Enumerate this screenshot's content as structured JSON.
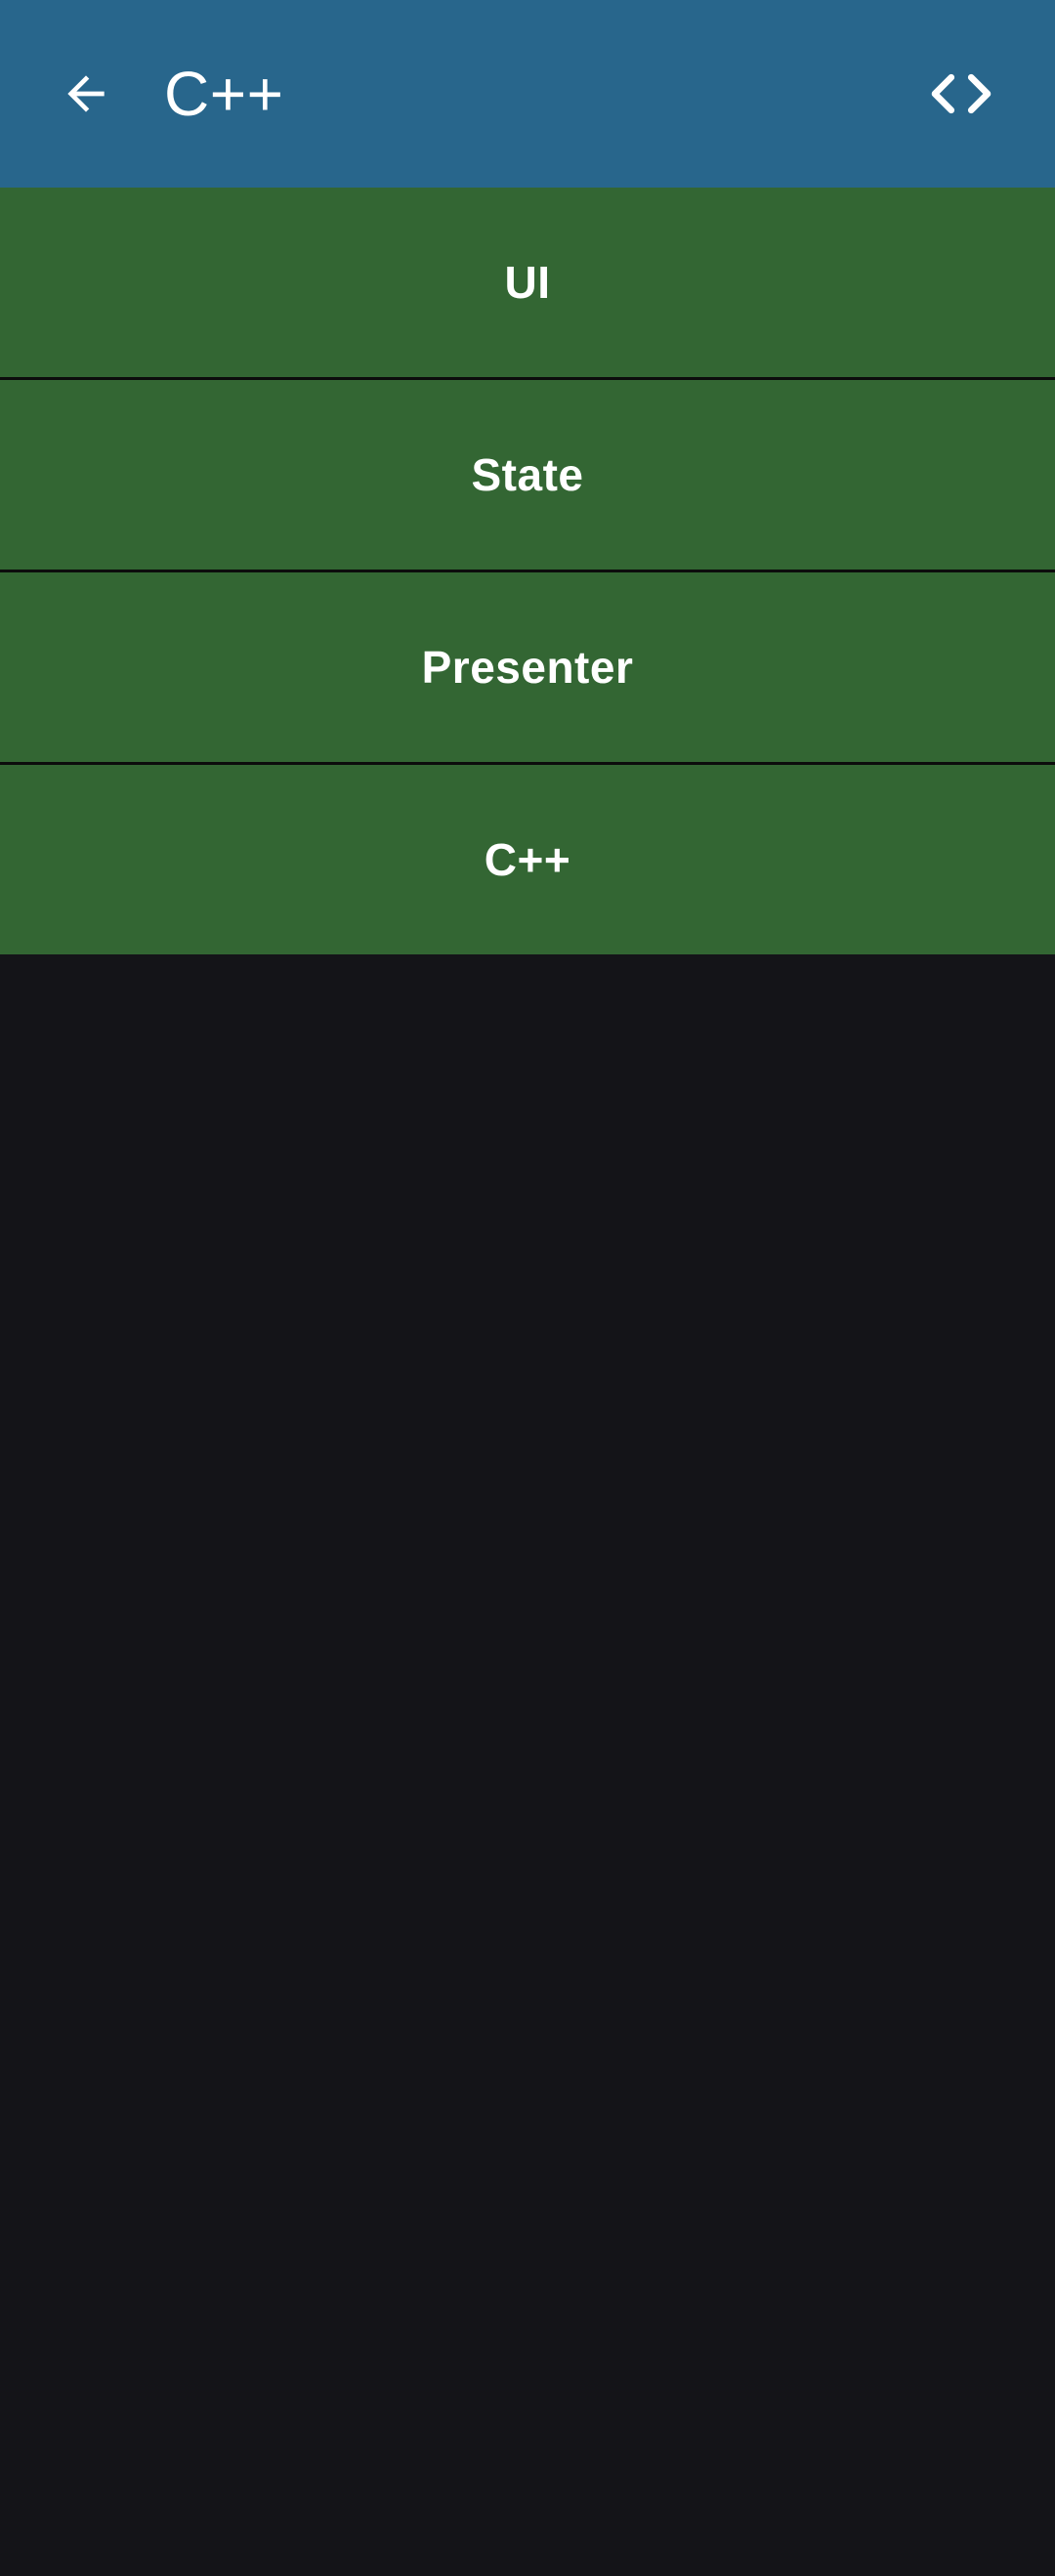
{
  "app_bar": {
    "title": "C++",
    "back_icon": "arrow-back-icon",
    "code_icon": "code-icon",
    "background": "#28668c"
  },
  "list": {
    "background": "#336633",
    "items": [
      {
        "label": "UI"
      },
      {
        "label": "State"
      },
      {
        "label": "Presenter"
      },
      {
        "label": "C++"
      }
    ]
  },
  "page_background": "#141418"
}
